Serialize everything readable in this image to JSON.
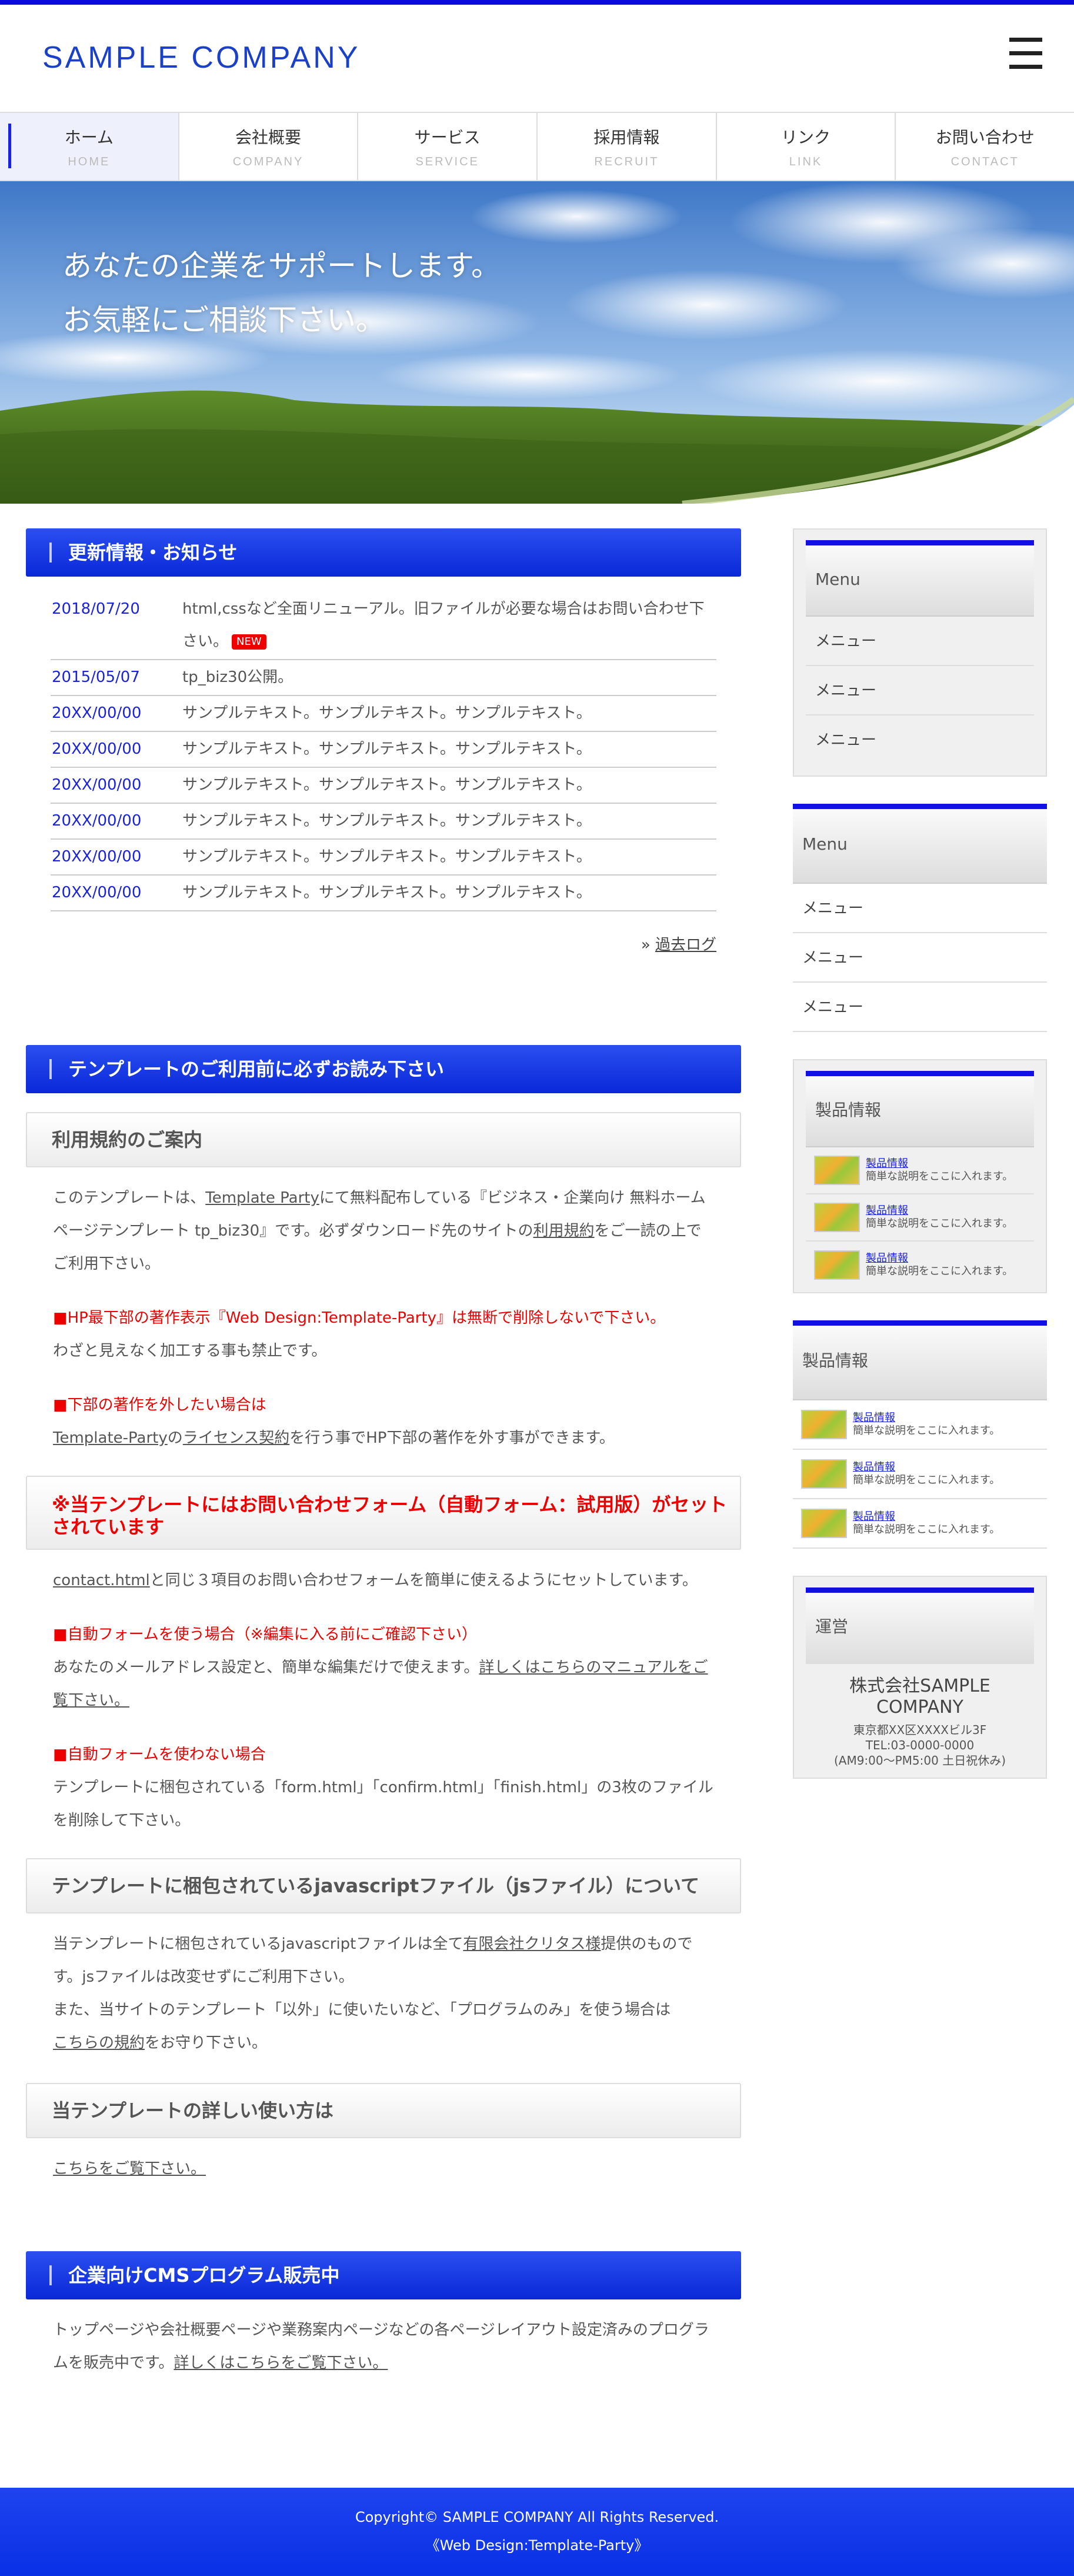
{
  "header": {
    "logo": "SAMPLE COMPANY"
  },
  "nav": [
    {
      "label": "ホーム",
      "sub": "HOME"
    },
    {
      "label": "会社概要",
      "sub": "COMPANY"
    },
    {
      "label": "サービス",
      "sub": "SERVICE"
    },
    {
      "label": "採用情報",
      "sub": "RECRUIT"
    },
    {
      "label": "リンク",
      "sub": "LINK"
    },
    {
      "label": "お問い合わせ",
      "sub": "CONTACT"
    }
  ],
  "hero": {
    "line1": "あなたの企業をサポートします。",
    "line2": "お気軽にご相談下さい。"
  },
  "news": {
    "title": "更新情報・お知らせ",
    "items": [
      {
        "date": "2018/07/20",
        "text": "html,cssなど全面リニューアル。旧ファイルが必要な場合はお問い合わせ下さい。",
        "badge": "NEW"
      },
      {
        "date": "2015/05/07",
        "text": "tp_biz30公開。"
      },
      {
        "date": "20XX/00/00",
        "text": "サンプルテキスト。サンプルテキスト。サンプルテキスト。"
      },
      {
        "date": "20XX/00/00",
        "text": "サンプルテキスト。サンプルテキスト。サンプルテキスト。"
      },
      {
        "date": "20XX/00/00",
        "text": "サンプルテキスト。サンプルテキスト。サンプルテキスト。"
      },
      {
        "date": "20XX/00/00",
        "text": "サンプルテキスト。サンプルテキスト。サンプルテキスト。"
      },
      {
        "date": "20XX/00/00",
        "text": "サンプルテキスト。サンプルテキスト。サンプルテキスト。"
      },
      {
        "date": "20XX/00/00",
        "text": "サンプルテキスト。サンプルテキスト。サンプルテキスト。"
      }
    ],
    "more_prefix": "» ",
    "more_label": "過去ログ"
  },
  "notice": {
    "title": "テンプレートのご利用前に必ずお読み下さい",
    "terms_heading": "利用規約のご案内",
    "terms_p1": "このテンプレートは、",
    "terms_link1": "Template Party",
    "terms_p2": "にて無料配布している『ビジネス・企業向け 無料ホームページテンプレート tp_biz30』です。必ずダウンロード先のサイトの",
    "terms_link2": "利用規約",
    "terms_p3": "をご一読の上でご利用下さい。",
    "red1": "■HP最下部の著作表示『Web Design:Template-Party』は無断で削除しないで下さい。",
    "red1_text": "わざと見えなく加工する事も禁止です。",
    "red2": "■下部の著作を外したい場合は",
    "red2_link1": "Template-Party",
    "red2_mid": "の",
    "red2_link2": "ライセンス契約",
    "red2_text": "を行う事でHP下部の著作を外す事ができます。",
    "form_heading": "※当テンプレートにはお問い合わせフォーム（自動フォーム：試用版）がセットされています",
    "form_link": "contact.html",
    "form_text": "と同じ３項目のお問い合わせフォームを簡単に使えるようにセットしています。",
    "red3": "■自動フォームを使う場合（※編集に入る前にご確認下さい）",
    "red3_text": "あなたのメールアドレス設定と、簡単な編集だけで使えます。",
    "red3_link": "詳しくはこちらのマニュアルをご覧下さい。",
    "red4": "■自動フォームを使わない場合",
    "red4_text": "テンプレートに梱包されている「form.html」「confirm.html」「finish.html」の3枚のファイルを削除して下さい。",
    "js_heading": "テンプレートに梱包されているjavascriptファイル（jsファイル）について",
    "js_p1": "当テンプレートに梱包されているjavascriptファイルは全て",
    "js_link1": "有限会社クリタス様",
    "js_p2": "提供のものです。jsファイルは改変せずにご利用下さい。",
    "js_p3": "また、当サイトのテンプレート「以外」に使いたいなど、「プログラムのみ」を使う場合は",
    "js_link2": "こちらの規約",
    "js_p4": "をお守り下さい。",
    "usage_heading": "当テンプレートの詳しい使い方は",
    "usage_link": "こちらをご覧下さい。"
  },
  "cms": {
    "title": "企業向けCMSプログラム販売中",
    "text": "トップページや会社概要ページや業務案内ページなどの各ページレイアウト設定済みのプログラムを販売中です。",
    "link": "詳しくはこちらをご覧下さい。"
  },
  "sidebar": {
    "menu1": {
      "title": "Menu",
      "items": [
        "メニュー",
        "メニュー",
        "メニュー"
      ]
    },
    "menu2": {
      "title": "Menu",
      "items": [
        "メニュー",
        "メニュー",
        "メニュー"
      ]
    },
    "products1": {
      "title": "製品情報",
      "items": [
        {
          "name": "製品情報",
          "desc": "簡単な説明をここに入れます。"
        },
        {
          "name": "製品情報",
          "desc": "簡単な説明をここに入れます。"
        },
        {
          "name": "製品情報",
          "desc": "簡単な説明をここに入れます。"
        }
      ]
    },
    "products2": {
      "title": "製品情報",
      "items": [
        {
          "name": "製品情報",
          "desc": "簡単な説明をここに入れます。"
        },
        {
          "name": "製品情報",
          "desc": "簡単な説明をここに入れます。"
        },
        {
          "name": "製品情報",
          "desc": "簡単な説明をここに入れます。"
        }
      ]
    },
    "company": {
      "title": "運営",
      "name": "株式会社SAMPLE COMPANY",
      "address": "東京都XX区XXXXビル3F",
      "tel": "TEL:03-0000-0000",
      "hours": "(AM9:00〜PM5:00 土日祝休み)"
    }
  },
  "footer": {
    "copyright": "Copyright© SAMPLE COMPANY All Rights Reserved.",
    "credit": "《Web Design:Template-Party》"
  },
  "colors": {
    "accent": "#1a22e0",
    "brand": "#1a3fc9",
    "warning": "#e00000"
  }
}
